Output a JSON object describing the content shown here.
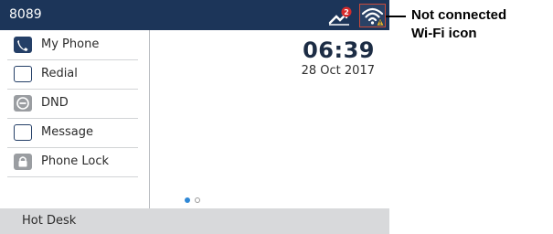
{
  "status_bar": {
    "extension": "8089",
    "missed_calls_badge": "2",
    "missed_calls_icon": "missed-call-arrow-icon",
    "wifi_icon": "wifi-not-connected-icon"
  },
  "softkeys": [
    {
      "label": "My Phone",
      "icon": "phone-icon",
      "style": "filled"
    },
    {
      "label": "Redial",
      "icon": "empty-key-icon",
      "style": "outline"
    },
    {
      "label": "DND",
      "icon": "dnd-icon",
      "style": "grey"
    },
    {
      "label": "Message",
      "icon": "empty-key-icon",
      "style": "outline"
    },
    {
      "label": "Phone Lock",
      "icon": "lock-icon",
      "style": "grey"
    }
  ],
  "clock": {
    "time": "06:39",
    "date": "28 Oct 2017"
  },
  "pager": {
    "pages": 2,
    "active_page": 1
  },
  "bottom_bar": {
    "label": "Hot Desk"
  },
  "callout": {
    "line1": "Not connected",
    "line2": "Wi-Fi icon"
  },
  "colors": {
    "status_bar": "#1c3559",
    "accent": "#2f88d6",
    "highlight_border": "#c94a3a",
    "warning": "#e8b32a"
  }
}
